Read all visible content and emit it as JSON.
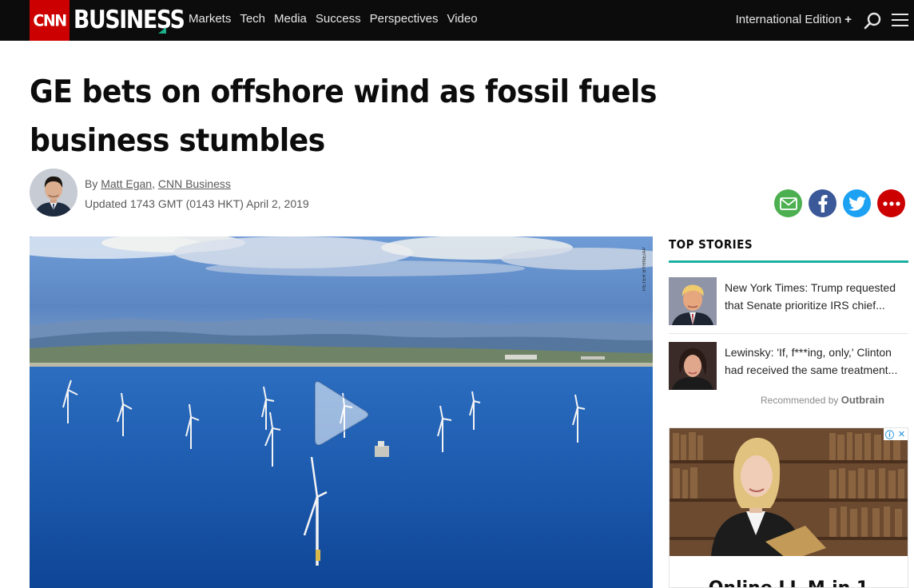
{
  "header": {
    "logo_text": "CNN",
    "section_logo": "BUSINESS",
    "nav": [
      "Markets",
      "Tech",
      "Media",
      "Success",
      "Perspectives",
      "Video"
    ],
    "edition": "International Edition",
    "edition_plus": "+"
  },
  "article": {
    "headline": "GE bets on offshore wind as fossil fuels business stumbles",
    "by_prefix": "By",
    "author": "Matt Egan",
    "separator": ",",
    "source": "CNN Business",
    "updated": "Updated 1743 GMT (0143 HKT) April 2, 2019"
  },
  "share": {
    "colors": {
      "email": "#4caf50",
      "facebook": "#3b5998",
      "twitter": "#1da1f2",
      "more": "#cc0000"
    }
  },
  "video": {
    "photo_credit": "PETER BYRNE/AP"
  },
  "rail": {
    "heading": "TOP STORIES",
    "stories": [
      {
        "line1": "New York Times: Trump requested",
        "line2": "that Senate prioritize IRS chief..."
      },
      {
        "line1": "Lewinsky: 'If, f***ing, only,' Clinton",
        "line2": "had received the same treatment..."
      }
    ],
    "recommended_label": "Recommended by",
    "recommended_brand": "Outbrain",
    "ad_caption": "Online LL.M.in 1"
  },
  "colors": {
    "brand_red": "#cc0000",
    "accent_teal": "#1db0a0",
    "nav_bg": "#0c0c0c"
  }
}
